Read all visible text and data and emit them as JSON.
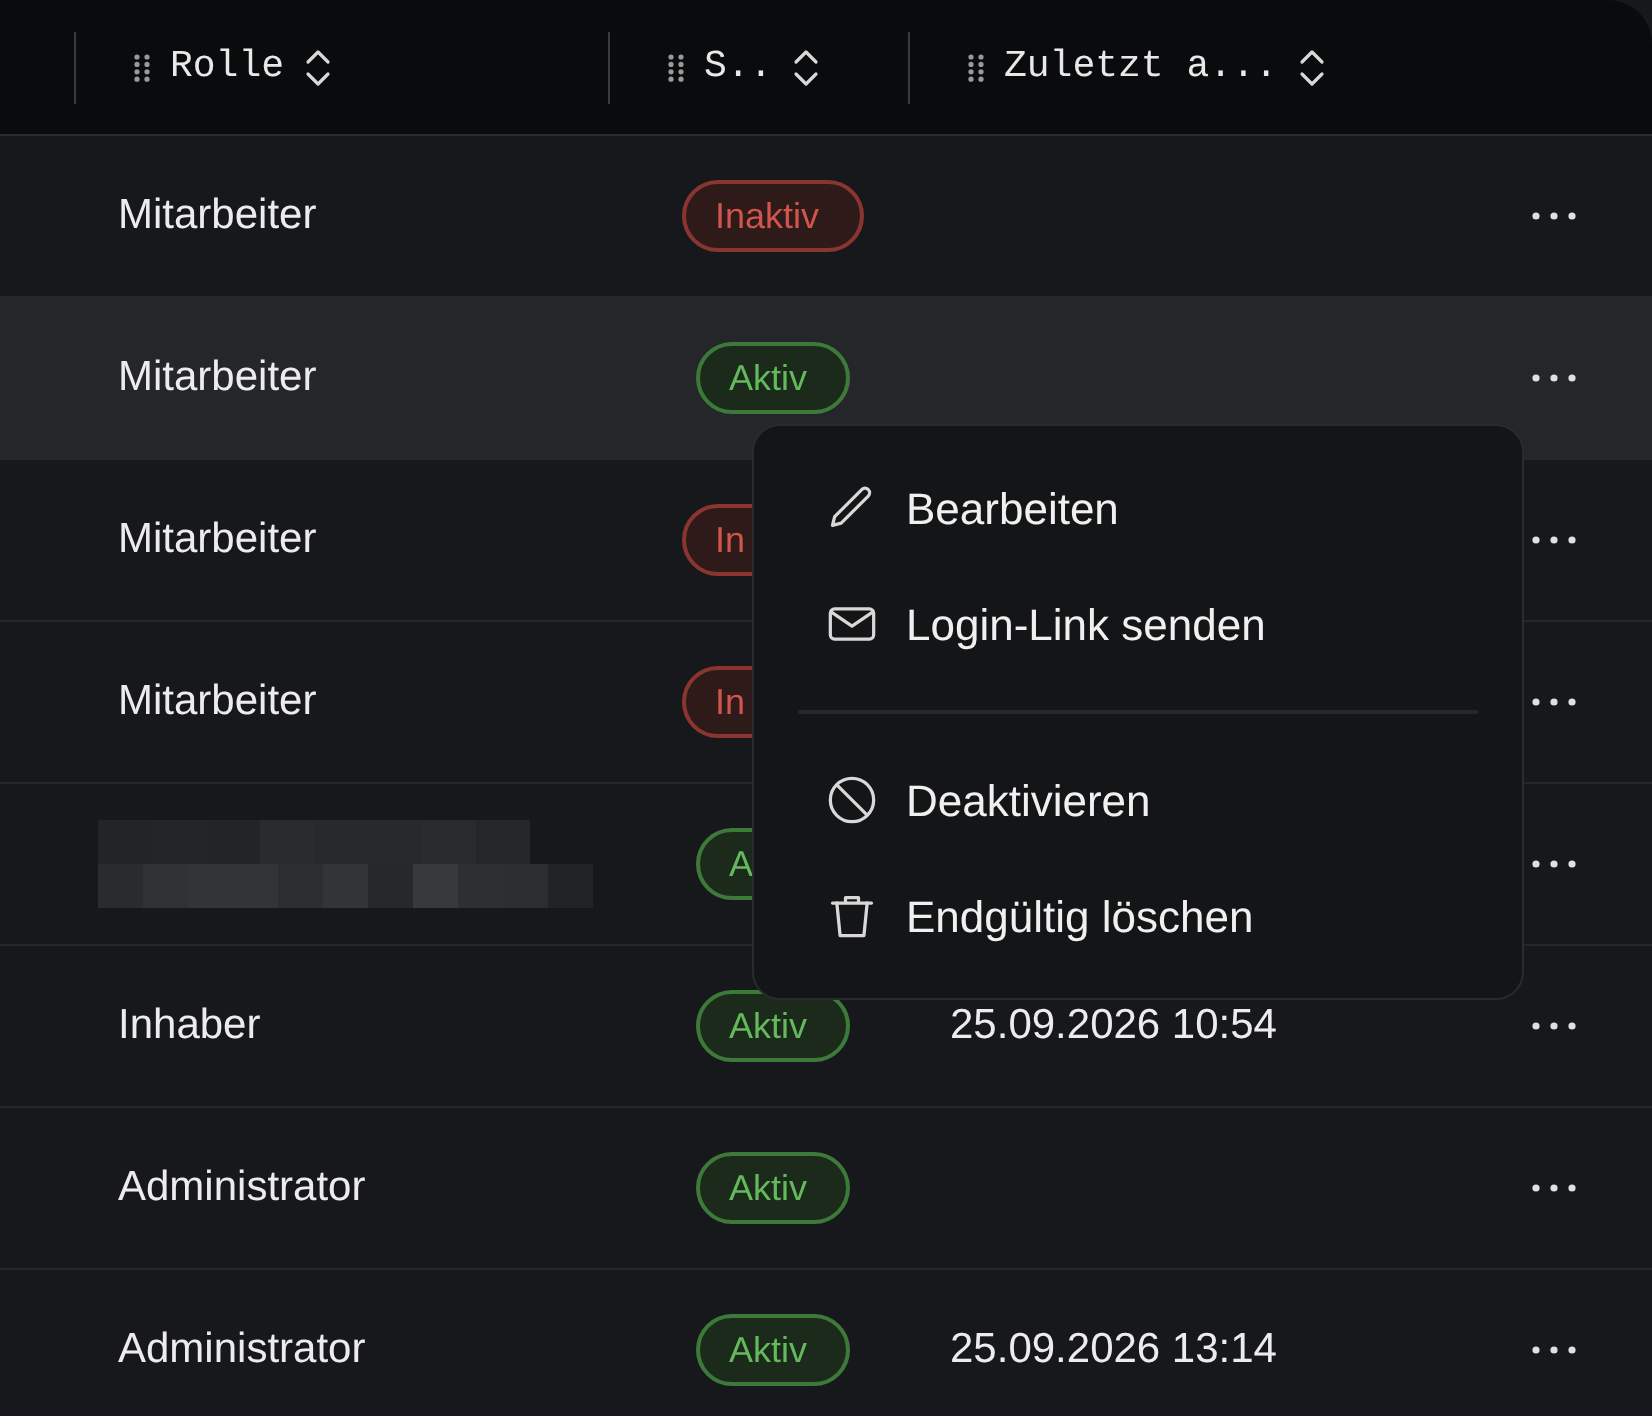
{
  "table": {
    "columns": [
      {
        "label": "Rolle"
      },
      {
        "label": "S.."
      },
      {
        "label": "Zuletzt a..."
      }
    ],
    "rows": [
      {
        "kind": "text",
        "role": "Mitarbeiter",
        "status": {
          "kind": "inactive",
          "label": "Inaktiv"
        },
        "hovered": false
      },
      {
        "kind": "text",
        "role": "Mitarbeiter",
        "status": {
          "kind": "active",
          "label": "Aktiv"
        },
        "hovered": true
      },
      {
        "kind": "text",
        "role": "Mitarbeiter",
        "status": {
          "kind": "inactive",
          "label": "In"
        },
        "hovered": false
      },
      {
        "kind": "text",
        "role": "Mitarbeiter",
        "status": {
          "kind": "inactive",
          "label": "In"
        },
        "hovered": false
      },
      {
        "kind": "redacted",
        "status": {
          "kind": "active",
          "label": "A"
        },
        "hovered": false
      },
      {
        "kind": "text",
        "role": "Inhaber",
        "status": {
          "kind": "active",
          "label": "Aktiv"
        },
        "last_active": "25.09.2026 10:54",
        "hovered": false
      },
      {
        "kind": "text",
        "role": "Administrator",
        "status": {
          "kind": "active",
          "label": "Aktiv"
        },
        "hovered": false
      },
      {
        "kind": "text",
        "role": "Administrator",
        "status": {
          "kind": "active",
          "label": "Aktiv"
        },
        "last_active": "25.09.2026 13:14",
        "hovered": false
      }
    ]
  },
  "context_menu": {
    "groups": [
      [
        {
          "label": "Bearbeiten"
        },
        {
          "label": "Login-Link senden"
        }
      ],
      [
        {
          "label": "Deaktivieren"
        },
        {
          "label": "Endgültig löschen"
        }
      ]
    ]
  }
}
